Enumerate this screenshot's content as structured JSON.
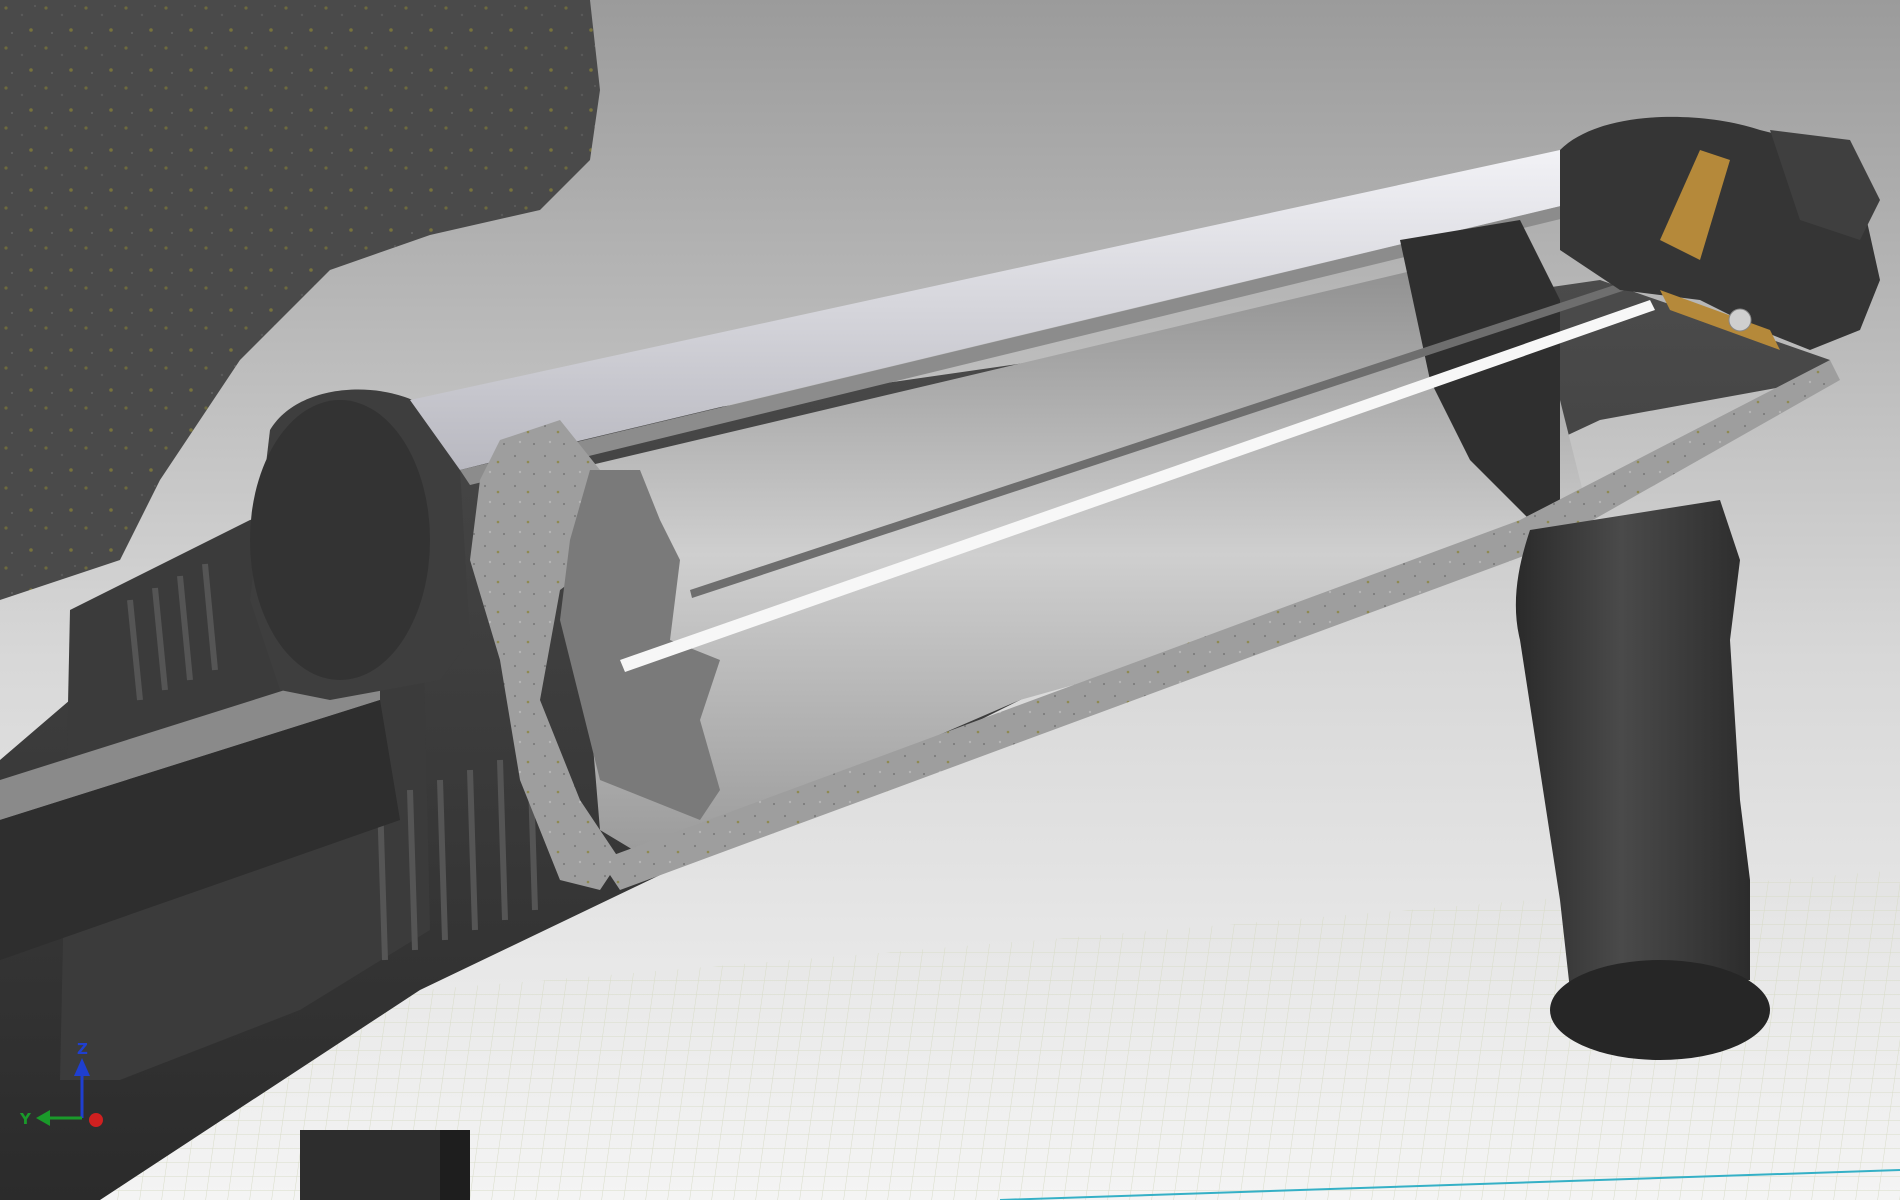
{
  "viewport": {
    "triad": {
      "z_label": "Z",
      "y_label": "Y",
      "colors": {
        "z": "#1f3fd0",
        "y": "#1a9a2a",
        "x": "#d02020"
      }
    },
    "colors": {
      "background_top": "#9b9b9b",
      "background_bottom": "#f2f2f2",
      "floor_grid": "#d8dcc6",
      "dark_part": "#3a3a3a",
      "section_face": "#a8a8a8",
      "tube_inner": "#d8d8dc",
      "brass": "#b5893a"
    }
  }
}
